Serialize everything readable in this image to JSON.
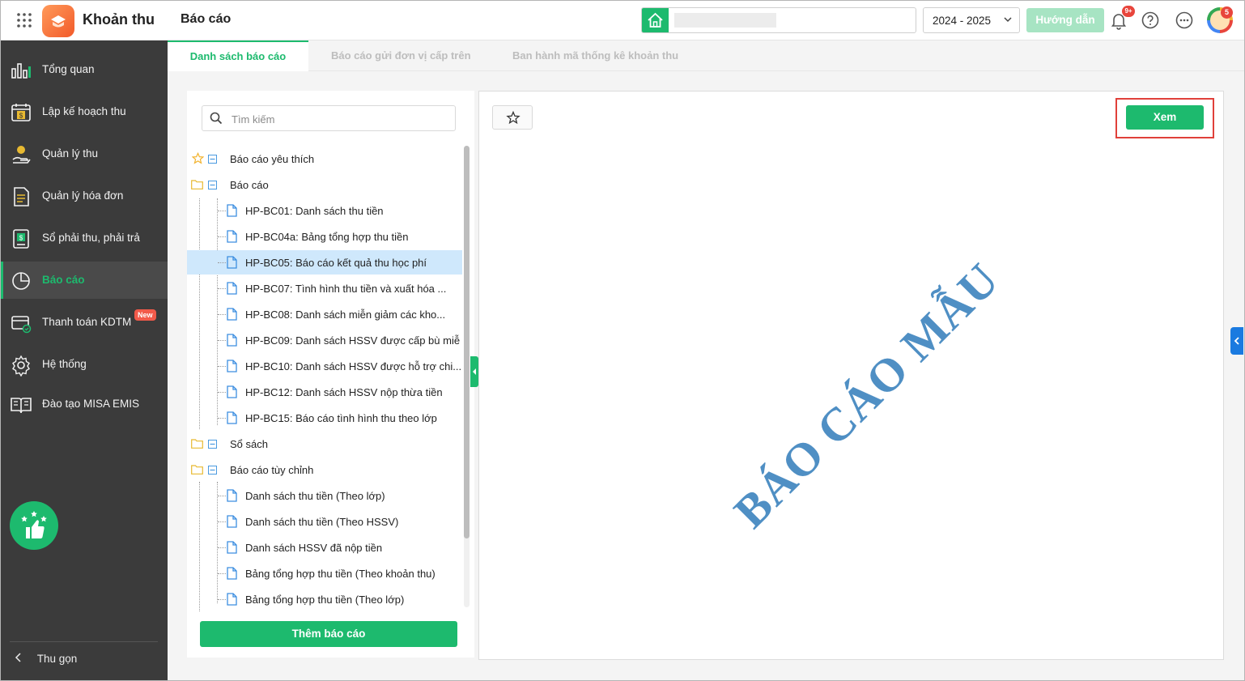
{
  "header": {
    "app_title": "Khoản thu",
    "page_title": "Báo cáo",
    "school_name": "",
    "year": "2024 - 2025",
    "guide_label": "Hướng dẫn",
    "notification_count": "9+",
    "avatar_badge": "5"
  },
  "sidebar": {
    "items": [
      {
        "label": "Tổng quan",
        "icon": "bar-chart-icon"
      },
      {
        "label": "Lập kế hoạch thu",
        "icon": "calendar-money-icon"
      },
      {
        "label": "Quản lý thu",
        "icon": "hand-coin-icon"
      },
      {
        "label": "Quản lý hóa đơn",
        "icon": "invoice-icon"
      },
      {
        "label": "Sổ phải thu, phải trả",
        "icon": "ledger-icon"
      },
      {
        "label": "Báo cáo",
        "icon": "pie-chart-icon"
      },
      {
        "label": "Thanh toán KDTM",
        "icon": "card-payment-icon",
        "badge": "New"
      },
      {
        "label": "Hệ thống",
        "icon": "gear-icon"
      },
      {
        "label": "Đào tạo MISA EMIS",
        "icon": "book-icon"
      }
    ],
    "collapse_label": "Thu gọn"
  },
  "tabs": [
    {
      "label": "Danh sách báo cáo",
      "active": true
    },
    {
      "label": "Báo cáo gửi đơn vị cấp trên",
      "active": false
    },
    {
      "label": "Ban hành mã thống kê khoản thu",
      "active": false
    }
  ],
  "search": {
    "placeholder": "Tìm kiếm",
    "value": ""
  },
  "tree": {
    "favorites": "Báo cáo yêu thích",
    "reports_folder": "Báo cáo",
    "reports": [
      "HP-BC01: Danh sách thu tiền",
      "HP-BC04a: Bảng tổng hợp thu tiền",
      "HP-BC05: Báo cáo kết quả thu học phí",
      "HP-BC07: Tình hình thu tiền và xuất hóa ...",
      "HP-BC08: Danh sách miễn giảm các kho...",
      "HP-BC09: Danh sách HSSV được cấp bù miễ",
      "HP-BC10: Danh sách HSSV được hỗ trợ chi...",
      "HP-BC12: Danh sách HSSV nộp thừa tiền",
      "HP-BC15: Báo cáo tình hình thu theo lớp"
    ],
    "selected_index": 2,
    "books_folder": "Sổ sách",
    "custom_folder": "Báo cáo tùy chỉnh",
    "custom_reports": [
      "Danh sách thu tiền (Theo lớp)",
      "Danh sách thu tiền (Theo HSSV)",
      "Danh sách HSSV đã nộp tiền",
      "Bảng tổng hợp thu tiền (Theo khoản thu)",
      "Bảng tổng hợp thu tiền (Theo lớp)"
    ]
  },
  "add_report_label": "Thêm báo cáo",
  "preview": {
    "view_label": "Xem",
    "watermark": "BÁO CÁO MẪU"
  },
  "colors": {
    "accent": "#1dba6e",
    "sidebar_bg": "#3b3b3b",
    "selected_row": "#cfe8fc",
    "watermark": "#4f8fc4",
    "highlight_outline": "#e0403a"
  }
}
